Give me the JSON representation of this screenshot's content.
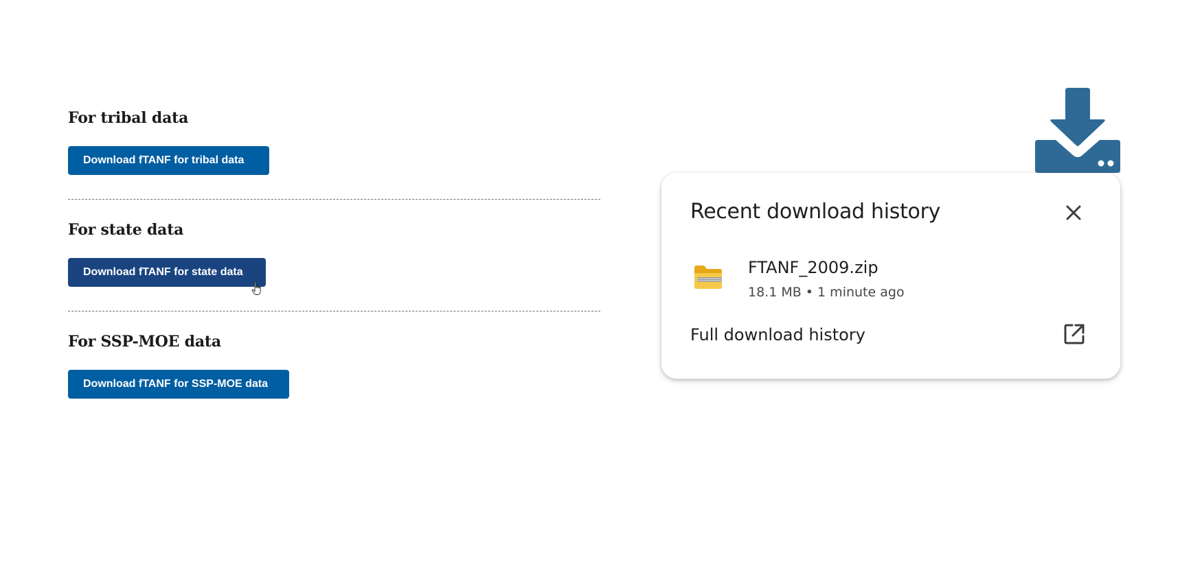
{
  "sections": [
    {
      "heading": "For tribal data",
      "button_label": "Download fTANF for tribal data"
    },
    {
      "heading": "For state data",
      "button_label": "Download fTANF for state data",
      "hovered": true
    },
    {
      "heading": "For SSP-MOE data",
      "button_label": "Download fTANF for SSP-MOE data"
    }
  ],
  "colors": {
    "button": "#005ea2",
    "button_hover": "#1a4480",
    "download_icon": "#2f6a96"
  },
  "icons": {
    "download": "download-tray-icon",
    "close": "close-icon",
    "file": "zip-folder-icon",
    "open_external": "open-external-icon",
    "cursor": "hand-pointer-cursor"
  },
  "popup": {
    "title": "Recent download history",
    "file": {
      "name": "FTANF_2009.zip",
      "meta": "18.1 MB • 1 minute ago"
    },
    "full_history_label": "Full download history"
  }
}
